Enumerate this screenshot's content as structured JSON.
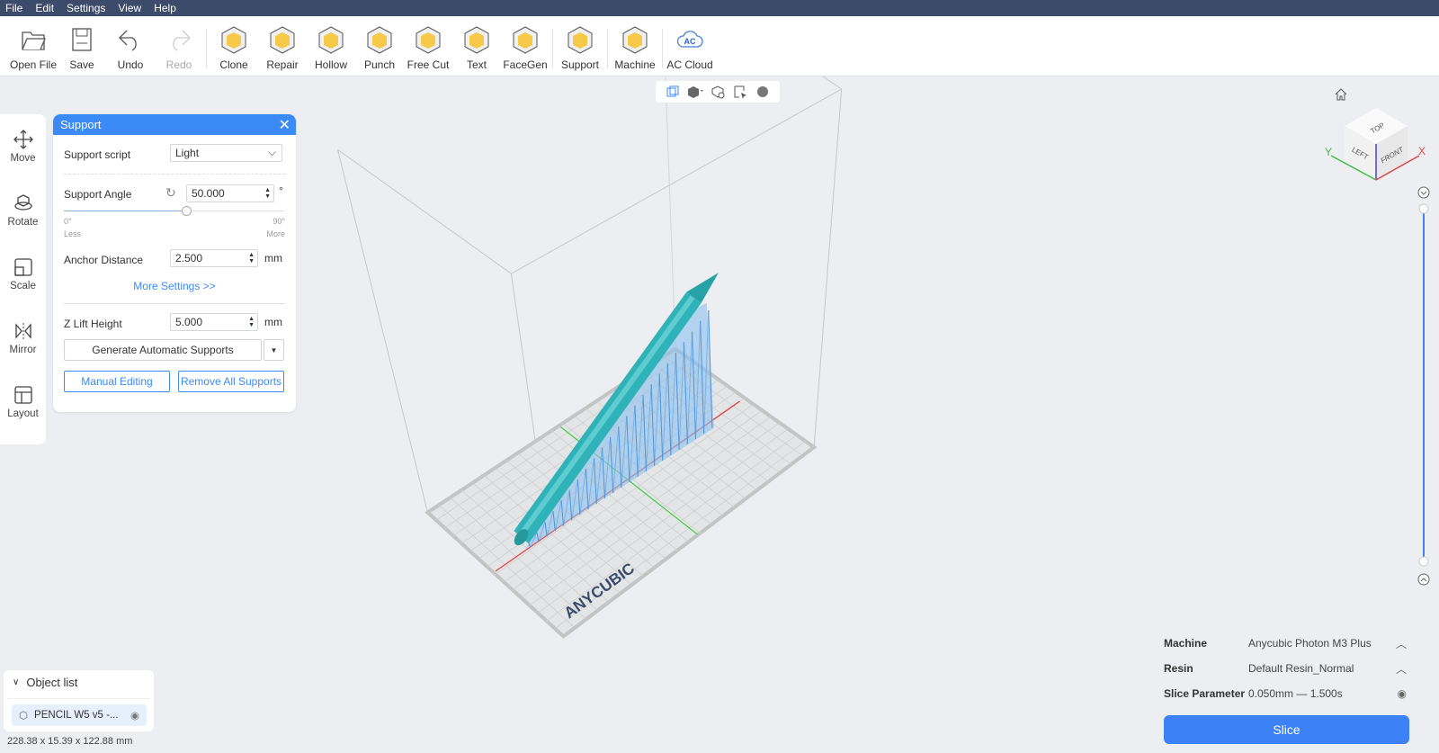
{
  "menu": [
    "File",
    "Edit",
    "Settings",
    "View",
    "Help"
  ],
  "toolbar": [
    {
      "label": "Open File",
      "icon": "folder-open-icon"
    },
    {
      "label": "Save",
      "icon": "save-icon"
    },
    {
      "label": "Undo",
      "icon": "undo-icon"
    },
    {
      "label": "Redo",
      "icon": "redo-icon",
      "disabled": true
    },
    {
      "label": "Clone",
      "icon": "clone-icon"
    },
    {
      "label": "Repair",
      "icon": "repair-icon"
    },
    {
      "label": "Hollow",
      "icon": "hollow-icon"
    },
    {
      "label": "Punch",
      "icon": "punch-icon"
    },
    {
      "label": "Free Cut",
      "icon": "free-cut-icon"
    },
    {
      "label": "Text",
      "icon": "text-icon"
    },
    {
      "label": "FaceGen",
      "icon": "facegen-icon"
    },
    {
      "label": "Support",
      "icon": "support-icon"
    },
    {
      "label": "Machine",
      "icon": "machine-icon"
    },
    {
      "label": "AC Cloud",
      "icon": "cloud-icon",
      "icon_text": "AC"
    }
  ],
  "left_tools": [
    {
      "label": "Move"
    },
    {
      "label": "Rotate"
    },
    {
      "label": "Scale"
    },
    {
      "label": "Mirror"
    },
    {
      "label": "Layout"
    }
  ],
  "support_panel": {
    "title": "Support",
    "script_label": "Support script",
    "script_value": "Light",
    "angle_label": "Support Angle",
    "angle_value": "50.000",
    "angle_unit": "°",
    "angle_min": "0°",
    "angle_max": "90°",
    "angle_min_caption": "Less",
    "angle_max_caption": "More",
    "angle_fraction": 0.5556,
    "anchor_label": "Anchor Distance",
    "anchor_value": "2.500",
    "anchor_unit": "mm",
    "more_settings": "More Settings >>",
    "zlift_label": "Z Lift Height",
    "zlift_value": "5.000",
    "zlift_unit": "mm",
    "generate": "Generate Automatic Supports",
    "manual": "Manual Editing",
    "remove": "Remove All Supports"
  },
  "object_list": {
    "title": "Object list",
    "items": [
      {
        "name": "PENCIL W5 v5 -..."
      }
    ]
  },
  "dimensions": "228.38 x 15.39 x 122.88 mm",
  "viewcube": {
    "top": "TOP",
    "left": "LEFT",
    "front": "FRONT",
    "x": "X",
    "y": "Y"
  },
  "plate_logo": "ANYCUBIC",
  "print_settings": {
    "machine_label": "Machine",
    "machine_value": "Anycubic Photon M3 Plus",
    "resin_label": "Resin",
    "resin_value": "Default Resin_Normal",
    "slice_param_label": "Slice Parameter",
    "slice_param_value": "0.050mm — 1.500s",
    "slice_button": "Slice"
  },
  "colors": {
    "accent": "#3c8af5",
    "menubar": "#3d4b6b",
    "model": "#2fb3b8",
    "supports": "#5aa2e8"
  }
}
